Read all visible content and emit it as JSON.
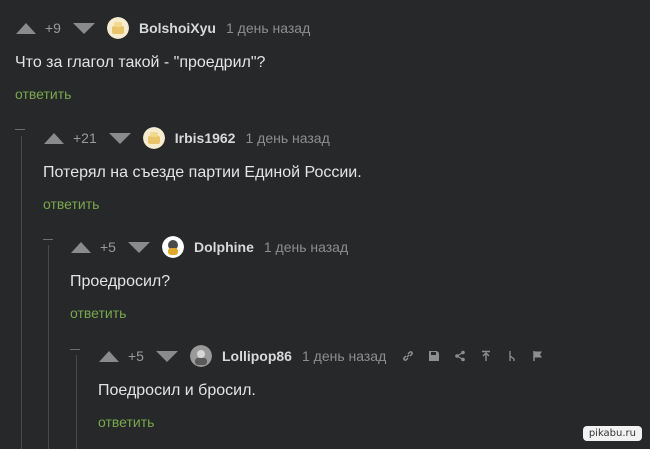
{
  "comments": [
    {
      "rating": "+9",
      "username": "BolshoiXyu",
      "time": "1 день назад",
      "text": "Что за глагол такой - \"проедрил\"?",
      "reply": "ответить"
    },
    {
      "rating": "+21",
      "username": "Irbis1962",
      "time": "1 день назад",
      "text": "Потерял на съезде партии Единой России.",
      "reply": "ответить"
    },
    {
      "rating": "+5",
      "username": "Dolphine",
      "time": "1 день назад",
      "text": "Проедросил?",
      "reply": "ответить"
    },
    {
      "rating": "+5",
      "username": "Lollipop86",
      "time": "1 день назад",
      "text": "Поедросил и бросил.",
      "reply": "ответить"
    }
  ],
  "toolbar_icons": [
    "link-icon",
    "save-icon",
    "share-icon",
    "go-to-parent-icon",
    "branch-icon",
    "report-flag-icon"
  ],
  "watermark": "pikabu.ru",
  "colors": {
    "background": "#262829",
    "reply_link": "#79a84d",
    "text": "#e4e4e4"
  }
}
